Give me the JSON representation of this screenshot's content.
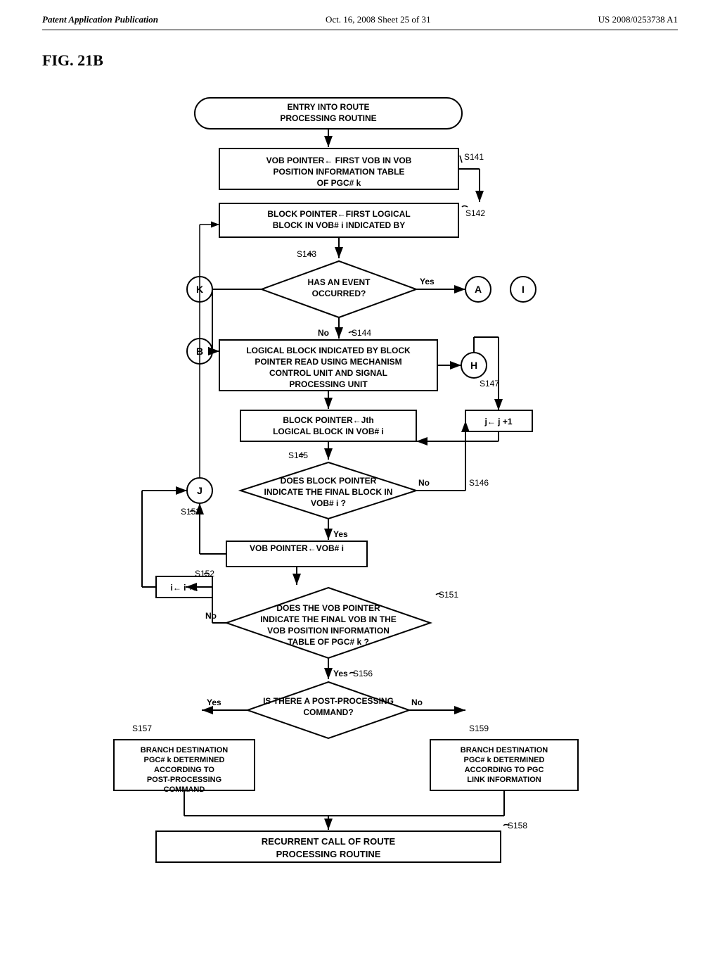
{
  "header": {
    "left": "Patent Application Publication",
    "center": "Oct. 16, 2008   Sheet 25 of 31",
    "right": "US 2008/0253738 A1"
  },
  "fig_label": "FIG. 21B",
  "nodes": {
    "entry": "ENTRY INTO ROUTE PROCESSING ROUTINE",
    "s141": "VOB POINTER← FIRST VOB IN VOB POSITION INFORMATION TABLE OF PGC# k",
    "s141_label": "S141",
    "s142": "BLOCK POINTER←FIRST LOGICAL BLOCK IN VOB# i INDICATED BY THE VOB POINTER",
    "s142_label": "S142",
    "s143_label": "S143",
    "has_event": "HAS AN EVENT OCCURRED?",
    "yes": "Yes",
    "no": "No",
    "s144_label": "S144",
    "logical_block": "LOGICAL BLOCK INDICATED BY BLOCK POINTER READ USING MECHANISM CONTROL UNIT AND SIGNAL PROCESSING UNIT",
    "s147_label": "S147",
    "block_ptr_jth": "BLOCK POINTER←Jth LOGICAL BLOCK IN VOB# i",
    "j_increment": "j← j +1",
    "s145_label": "S145",
    "does_block_final": "DOES BLOCK POINTER INDICATE THE FINAL BLOCK IN VOB# i ?",
    "no2": "No",
    "s146_label": "S146",
    "yes2": "Yes",
    "s153_label": "S153",
    "vob_ptr_assign": "VOB POINTER←VOB# i",
    "i_increment": "i← i +1",
    "s152_label": "S152",
    "does_vob_final_label": "S151",
    "does_vob_final": "DOES THE VOB POINTER INDICATE THE FINAL VOB IN THE VOB POSITION INFORMATION TABLE OF PGC# k ?",
    "no3": "No",
    "yes3": "Yes",
    "s156_label": "S156",
    "is_post": "IS THERE A POST-PROCESSING COMMAND?",
    "yes4": "Yes",
    "no4": "No",
    "s157_label": "S157",
    "s159_label": "S159",
    "branch_yes": "BRANCH DESTINATION PGC# k DETERMINED ACCORDING TO POST-PROCESSING COMMAND",
    "branch_no": "BRANCH DESTINATION PGC# k DETERMINED ACCORDING TO PGC LINK INFORMATION",
    "s158_label": "S158",
    "recurrent": "RECURRENT CALL OF ROUTE PROCESSING ROUTINE",
    "circle_K": "K",
    "circle_B": "B",
    "circle_A": "A",
    "circle_I": "I",
    "circle_H": "H",
    "circle_J": "J"
  }
}
